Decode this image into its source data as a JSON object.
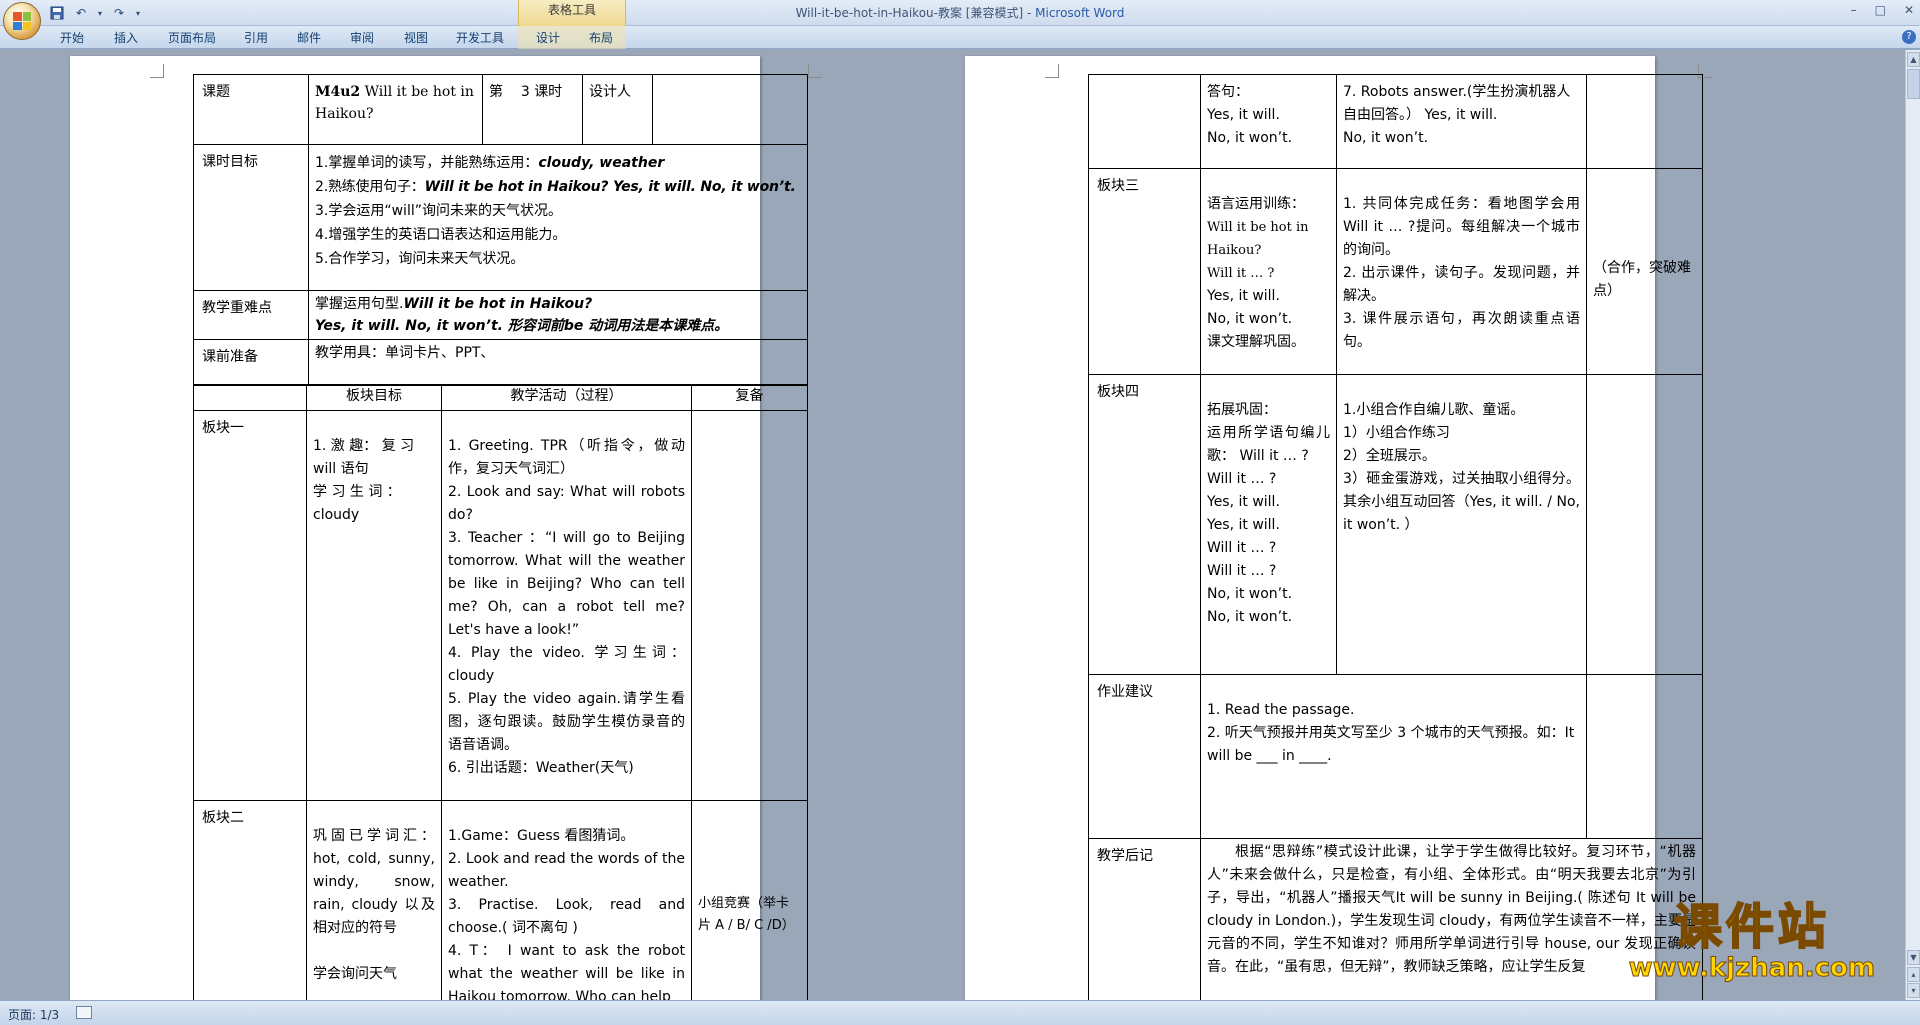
{
  "window": {
    "title": "Will-it-be-hot-in-Haikou-教案 [兼容模式] - ",
    "app_name": "Microsoft Word",
    "contextual_tools": "表格工具",
    "min": "–",
    "max": "□",
    "close": "✕"
  },
  "ribbon": {
    "tabs": [
      "开始",
      "插入",
      "页面布局",
      "引用",
      "邮件",
      "审阅",
      "视图",
      "开发工具",
      "设计",
      "布局"
    ]
  },
  "statusbar": {
    "page": "页面: 1/3"
  },
  "watermark": {
    "text": "课件站",
    "url": "www.kjzhan.com"
  },
  "colors": {
    "ribbon": "#cfdcee",
    "context_tools": "#efd98f",
    "workspace": "#9aa7b8",
    "watermark": "#ffd400"
  },
  "left_page": {
    "header": {
      "label": "课题",
      "topic_code": "M4u2",
      "topic_text": "Will it be hot in Haikou?",
      "period_a": "第",
      "period_b": "3",
      "period_c": "课时",
      "designer": "设计人"
    },
    "objectives": {
      "label": "课时目标",
      "lines": [
        {
          "plain": "1.掌握单词的读写，并能熟练运用：",
          "bold": "cloudy,  weather"
        },
        {
          "plain": "2.熟练使用句子：",
          "bold": "Will it be hot in Haikou? Yes, it will. No, it won’t."
        },
        {
          "plain": "3.学会运用“will”询问未来的天气状况。",
          "bold": ""
        },
        {
          "plain": "4.增强学生的英语口语表达和运用能力。",
          "bold": ""
        },
        {
          "plain": "5.合作学习，询问未来天气状况。",
          "bold": ""
        }
      ]
    },
    "focus": {
      "label": "教学重难点",
      "line1_plain": "掌握运用句型.",
      "line1_bold": "Will it be hot in Haikou?",
      "line2_bold": "Yes, it will.  No, it won’t.  形容词前be 动词用法是本课难点。"
    },
    "prep": {
      "label": "课前准备",
      "text": "教学用具：单词卡片、PPT、"
    },
    "columns": {
      "goal": "板块目标",
      "activity": "教学活动（过程）",
      "note": "复备"
    },
    "block1": {
      "label": "板块一",
      "goal": [
        "1. 激 趣： 复 习",
        "will 语句",
        "学 习 生 词 ：",
        "cloudy"
      ],
      "activity": [
        "1. Greeting. TPR（听指令，做动作，复习天气词汇）",
        "2.  Look  and  say:  What  will robots do?",
        "3. Teacher ：“I will go to Beijing tomorrow.  What  will  the weather be like in Beijing? Who can tell me? Oh, can a robot tell me? Let's have a look!”",
        "4.  Play  the  video.  学习生词：cloudy",
        "5.  Play  the  video  again.请学生看图，逐句跟读。鼓励学生模仿录音的语音语调。",
        "6. 引出话题：Weather(天气)"
      ]
    },
    "block2": {
      "label": "板块二",
      "goal": [
        "巩固已学词汇：hot, cold, sunny, windy,  snow, rain, cloudy 以及相对应的符号",
        "",
        "学会询问天气"
      ],
      "activity": [
        "1.Game：Guess 看图猜词。",
        "2.  Look and read the words of the weather.",
        "3.  Practise.  Look,  read  and choose.(  词不离句 )",
        "4.  T： I  want to ask the robot what the weather will be like in Haikou tomorrow. Who can help"
      ],
      "note": "小组竞赛（举卡片 A / B/ C /D）"
    }
  },
  "right_page": {
    "row0": {
      "goal": [
        "答句：",
        "Yes, it will.",
        "No, it won’t."
      ],
      "activity": [
        "7. Robots  answer.(学生扮演机器人自由回答。）  Yes, it will.",
        "No, it won’t."
      ]
    },
    "block3": {
      "label": "板块三",
      "goal": [
        "语言运用训练：",
        "Will  it  be  hot  in Haikou?",
        "Will it … ?",
        "Yes, it will.",
        "No, it won’t.",
        "课文理解巩固。"
      ],
      "activity": [
        "1. 共同体完成任务：看地图学会用 Will it … ?提问。每组解决一个城市的询问。",
        "2. 出示课件，读句子。发现问题，并解决。",
        "3. 课件展示语句，再次朗读重点语句。"
      ],
      "note": "（合作，突破难点）"
    },
    "block4": {
      "label": "板块四",
      "goal": [
        "拓展巩固：",
        "运用所学语句编儿歌：  Will it   …   ?",
        "Will it   …  ?",
        "Yes,   it   will.",
        "Yes, it will.",
        "Will  it   …   ?",
        "Will it   …  ?",
        "No,  it won’t.",
        "No, it won’t."
      ],
      "activity": [
        "1.小组合作自编儿歌、童谣。",
        "1）小组合作练习",
        "2）全班展示。",
        "3）砸金蛋游戏，过关抽取小组得分。其余小组互动回答（Yes, it will. /  No, it won’t.  ）"
      ]
    },
    "homework": {
      "label": "作业建议",
      "lines": [
        "1. Read the passage.",
        "2. 听天气预报并用英文写至少 3 个城市的天气预报。如：It will be ___ in ____."
      ]
    },
    "reflection": {
      "label": "教学后记",
      "text": "根据“思辩练”模式设计此课，让学于学生做得比较好。复习环节，“机器人”未来会做什么，只是检查，有小组、全体形式。由“明天我要去北京”为引子，导出，“机器人”播报天气It will be sunny in Beijing.( 陈述句 It will be cloudy in London.)，学生发现生词 cloudy，有两位学生读音不一样，主要是元音的不同，学生不知谁对？师用所学单词进行引导 house, our 发现正确读音。在此，“虽有思，但无辩”，教师缺乏策略，应让学生反复"
    }
  }
}
